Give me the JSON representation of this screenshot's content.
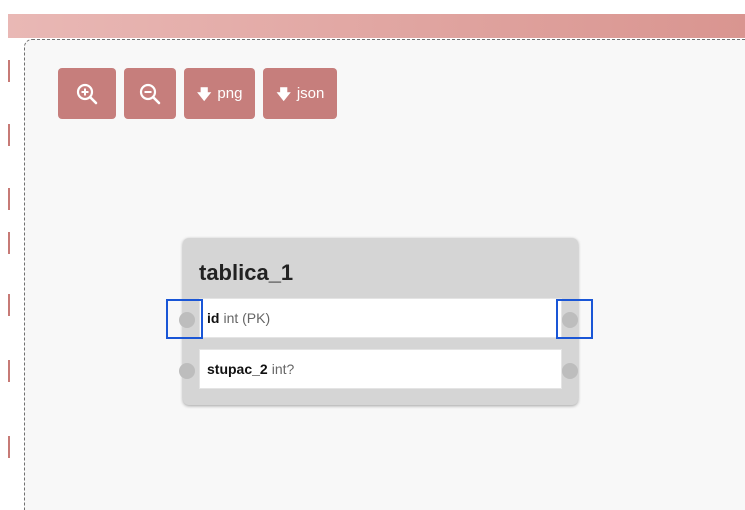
{
  "toolbar": {
    "zoom_in": {
      "icon": "zoom-in-icon"
    },
    "zoom_out": {
      "icon": "zoom-out-icon"
    },
    "export_png": {
      "icon": "arrow-down-icon",
      "arrow": "🡇",
      "label": "png"
    },
    "export_json": {
      "icon": "arrow-down-icon",
      "arrow": "🡇",
      "label": "json"
    }
  },
  "table": {
    "title": "tablica_1",
    "columns": [
      {
        "name": "id",
        "type": "int (PK)"
      },
      {
        "name": "stupac_2",
        "type": "int?"
      }
    ]
  },
  "colors": {
    "button": "#c67e7c",
    "header_bar": "#d99590",
    "highlight": "#1a56d6"
  }
}
